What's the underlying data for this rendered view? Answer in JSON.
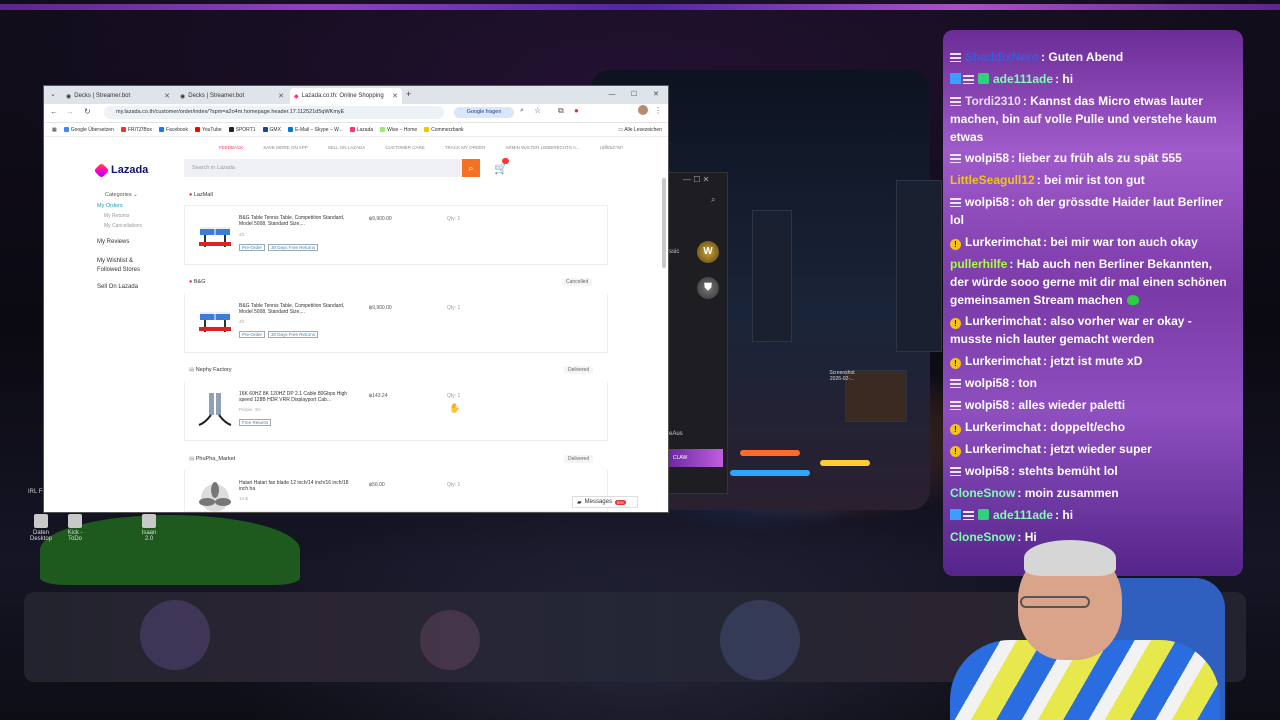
{
  "browser": {
    "tabs": [
      {
        "label": "Decks | Streamer.bot"
      },
      {
        "label": "Decks | Streamer.bot"
      },
      {
        "label": "Lazada.co.th: Online Shopping"
      }
    ],
    "new_tab": "+",
    "url": "my.lazada.co.th/customer/order/index/?spm=a2o4m.homepage.header.17.112521d5qWKmyE",
    "google_button": "Google fragen",
    "bookmarks": [
      "Google Übersetzen",
      "FRITZ!Box",
      "Facebook",
      "YouTube",
      "SPORT1",
      "GMX",
      "E-Mail – Skype – W...",
      "Lazada",
      "Wise – Home",
      "Commerzbank"
    ],
    "all_bookmarks": "Alle Lesezeichen"
  },
  "lazada": {
    "topnav": [
      "FEEDBACK",
      "SAVE MORE ON APP",
      "SELL ON LAZADA",
      "CUSTOMER CARE",
      "TRACK MY ORDER",
      "ARMIN WALTER LIEBERECHTS A...",
      "เปลี่ยนภาษา"
    ],
    "logo": "Lazada",
    "search_placeholder": "Search in Lazada",
    "categories": "Categories",
    "sidebar": {
      "my_orders": "My Orders",
      "my_returns": "My Returns",
      "my_cancellations": "My Cancellations",
      "my_reviews": "My Reviews",
      "wishlist": "My Wishlist & Followed Stores",
      "sell": "Sell On Lazada"
    },
    "orders": [
      {
        "store": "LazMall",
        "status": "",
        "title": "B&G Table Tennis Table, Competition Standard, Model 5008, Standard Size,...",
        "variant": "4ft",
        "price": "฿9,900.00",
        "qty": "Qty: 1",
        "tags": [
          "Pre-Order",
          "30 Days Free Returns"
        ]
      },
      {
        "store": "B&G",
        "status": "Cancelled",
        "title": "B&G Table Tennis Table, Competition Standard, Model 5008, Standard Size,...",
        "variant": "4ft",
        "price": "฿9,900.00",
        "qty": "Qty: 1",
        "tags": [
          "Pre-Order",
          "30 Days Free Returns"
        ]
      },
      {
        "store": "Nephy Factory",
        "status": "Delivered",
        "title": "16K 60HZ 8K 120HZ DP 2.1 Cable 80Gbps High speed 128B HDR VRR Displayport Cab...",
        "variant": "Purple, 3m",
        "price": "฿143.24",
        "qty": "Qty: 1",
        "tags": [
          "Free Returns"
        ]
      },
      {
        "store": "PhuPha_Market",
        "status": "Delivered",
        "title": "Hatari Hatari fan blade 12 inch/14 inch/16 inch/18 inch ha",
        "variant": "14 ฿",
        "price": "฿56.00",
        "qty": "Qty: 1",
        "tags": []
      }
    ],
    "messages": "Messages",
    "messages_badge": "999"
  },
  "dark_window": {
    "label1": "ssic",
    "label2": "eAus",
    "label3": "CLAW"
  },
  "desktop": {
    "screenshot_label": "Screenshot 2026-02-...",
    "icons": [
      {
        "label": "Daten Desktop"
      },
      {
        "label": "Kick - ToDo"
      },
      {
        "label": "Isaan 2.0"
      }
    ],
    "left_label": "IRL Fe"
  },
  "chat": [
    {
      "user": "ShaddixNero",
      "color": "#3b5bdb",
      "badge": "eq",
      "msg": "Guten Abend"
    },
    {
      "user": "ade111ade",
      "color": "#7cffb0",
      "badge": "multi",
      "msg": "hi"
    },
    {
      "user": "Tordi2310",
      "color": "#e8d9f5",
      "badge": "eq",
      "msg": "Kannst das Micro etwas lauter machen, bin auf volle Pulle und verstehe kaum etwas"
    },
    {
      "user": "wolpi58",
      "color": "#ffffff",
      "badge": "eq",
      "msg": "lieber zu früh als zu spät 555"
    },
    {
      "user": "LittleSeagull12",
      "color": "#f0c419",
      "badge": "",
      "msg": "bei mir ist ton gut"
    },
    {
      "user": "wolpi58",
      "color": "#ffffff",
      "badge": "eq",
      "msg": "oh der grössdte Haider laut Berliner lol"
    },
    {
      "user": "Lurkerimchat",
      "color": "#ffffff",
      "badge": "warn",
      "msg": "bei mir war ton auch okay"
    },
    {
      "user": "pullerhilfe",
      "color": "#a6ff3b",
      "badge": "",
      "msg": "Hab auch nen Berliner Bekannten, der würde sooo gerne mit dir mal einen schönen gemeinsamen Stream machen"
    },
    {
      "user": "Lurkerimchat",
      "color": "#ffffff",
      "badge": "warn",
      "msg": "also vorher war er okay - musste nich lauter gemacht werden"
    },
    {
      "user": "Lurkerimchat",
      "color": "#ffffff",
      "badge": "warn",
      "msg": "jetzt ist mute xD"
    },
    {
      "user": "wolpi58",
      "color": "#ffffff",
      "badge": "eq",
      "msg": "ton"
    },
    {
      "user": "wolpi58",
      "color": "#ffffff",
      "badge": "eq",
      "msg": "alles wieder paletti"
    },
    {
      "user": "Lurkerimchat",
      "color": "#ffffff",
      "badge": "warn",
      "msg": "doppelt/echo"
    },
    {
      "user": "Lurkerimchat",
      "color": "#ffffff",
      "badge": "warn",
      "msg": "jetzt wieder super"
    },
    {
      "user": "wolpi58",
      "color": "#ffffff",
      "badge": "eq",
      "msg": "stehts bemüht lol"
    },
    {
      "user": "CloneSnow",
      "color": "#7cffb0",
      "badge": "",
      "msg": "moin zusammen"
    },
    {
      "user": "ade111ade",
      "color": "#7cffb0",
      "badge": "multi",
      "msg": "hi"
    },
    {
      "user": "CloneSnow",
      "color": "#7cffb0",
      "badge": "",
      "msg": "Hi"
    }
  ]
}
